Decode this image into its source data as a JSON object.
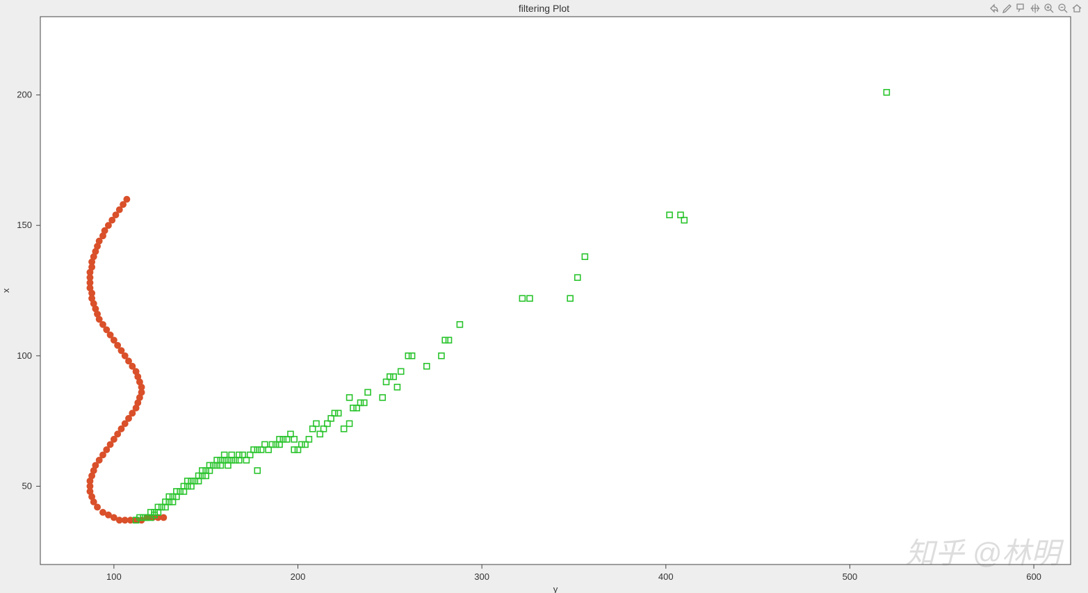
{
  "title": "filtering Plot",
  "xlabel": "y",
  "ylabel": "x",
  "watermark": "知乎 @林明",
  "toolbar": {
    "share": "share-icon",
    "brush": "brush-icon",
    "datatips": "datatips-icon",
    "pan": "pan-icon",
    "zoomin": "zoom-in-icon",
    "zoomout": "zoom-out-icon",
    "home": "home-icon"
  },
  "chart_data": {
    "type": "scatter",
    "xlim": [
      60,
      620
    ],
    "ylim": [
      20,
      230
    ],
    "xticks": [
      100,
      200,
      300,
      400,
      500,
      600
    ],
    "yticks": [
      50,
      100,
      150,
      200
    ],
    "series": [
      {
        "name": "orange",
        "color": "#d9502a",
        "marker": "circle",
        "filled": true,
        "points_xy": [
          [
            107,
            160
          ],
          [
            105,
            158
          ],
          [
            103,
            156
          ],
          [
            101,
            154
          ],
          [
            99,
            152
          ],
          [
            97,
            150
          ],
          [
            95,
            148
          ],
          [
            94,
            146
          ],
          [
            92,
            144
          ],
          [
            91,
            142
          ],
          [
            90,
            140
          ],
          [
            89,
            138
          ],
          [
            88,
            136
          ],
          [
            88,
            134
          ],
          [
            87,
            132
          ],
          [
            87,
            130
          ],
          [
            87,
            128
          ],
          [
            87,
            126
          ],
          [
            88,
            124
          ],
          [
            88,
            122
          ],
          [
            89,
            120
          ],
          [
            90,
            118
          ],
          [
            91,
            116
          ],
          [
            92,
            114
          ],
          [
            94,
            112
          ],
          [
            96,
            110
          ],
          [
            98,
            108
          ],
          [
            100,
            106
          ],
          [
            102,
            104
          ],
          [
            104,
            102
          ],
          [
            106,
            100
          ],
          [
            108,
            98
          ],
          [
            110,
            96
          ],
          [
            112,
            94
          ],
          [
            113,
            92
          ],
          [
            114,
            90
          ],
          [
            115,
            88
          ],
          [
            115,
            86
          ],
          [
            114,
            84
          ],
          [
            113,
            82
          ],
          [
            112,
            80
          ],
          [
            110,
            78
          ],
          [
            108,
            76
          ],
          [
            106,
            74
          ],
          [
            104,
            72
          ],
          [
            102,
            70
          ],
          [
            100,
            68
          ],
          [
            98,
            66
          ],
          [
            96,
            64
          ],
          [
            94,
            62
          ],
          [
            92,
            60
          ],
          [
            90,
            58
          ],
          [
            89,
            56
          ],
          [
            88,
            54
          ],
          [
            87,
            52
          ],
          [
            87,
            50
          ],
          [
            87,
            48
          ],
          [
            88,
            46
          ],
          [
            89,
            44
          ],
          [
            91,
            42
          ],
          [
            94,
            40
          ],
          [
            97,
            39
          ],
          [
            100,
            38
          ],
          [
            103,
            37
          ],
          [
            106,
            37
          ],
          [
            109,
            37
          ],
          [
            112,
            37
          ],
          [
            115,
            37
          ],
          [
            118,
            38
          ],
          [
            121,
            38
          ],
          [
            124,
            38
          ],
          [
            127,
            38
          ]
        ]
      },
      {
        "name": "green",
        "color": "#28c32b",
        "marker": "square",
        "filled": false,
        "points_xy": [
          [
            112,
            37
          ],
          [
            114,
            38
          ],
          [
            116,
            38
          ],
          [
            118,
            38
          ],
          [
            120,
            38
          ],
          [
            120,
            40
          ],
          [
            122,
            40
          ],
          [
            122,
            39
          ],
          [
            124,
            40
          ],
          [
            124,
            42
          ],
          [
            126,
            42
          ],
          [
            128,
            42
          ],
          [
            128,
            44
          ],
          [
            130,
            44
          ],
          [
            130,
            46
          ],
          [
            132,
            44
          ],
          [
            132,
            46
          ],
          [
            134,
            46
          ],
          [
            134,
            48
          ],
          [
            136,
            48
          ],
          [
            138,
            48
          ],
          [
            138,
            50
          ],
          [
            140,
            50
          ],
          [
            140,
            52
          ],
          [
            142,
            50
          ],
          [
            142,
            52
          ],
          [
            144,
            52
          ],
          [
            146,
            52
          ],
          [
            146,
            54
          ],
          [
            148,
            54
          ],
          [
            148,
            56
          ],
          [
            150,
            54
          ],
          [
            150,
            56
          ],
          [
            152,
            56
          ],
          [
            152,
            58
          ],
          [
            154,
            58
          ],
          [
            156,
            58
          ],
          [
            156,
            60
          ],
          [
            158,
            58
          ],
          [
            158,
            60
          ],
          [
            160,
            60
          ],
          [
            160,
            62
          ],
          [
            162,
            58
          ],
          [
            162,
            60
          ],
          [
            164,
            60
          ],
          [
            164,
            62
          ],
          [
            166,
            60
          ],
          [
            168,
            60
          ],
          [
            168,
            62
          ],
          [
            170,
            62
          ],
          [
            172,
            60
          ],
          [
            174,
            62
          ],
          [
            176,
            64
          ],
          [
            178,
            64
          ],
          [
            178,
            56
          ],
          [
            180,
            64
          ],
          [
            182,
            66
          ],
          [
            184,
            64
          ],
          [
            186,
            66
          ],
          [
            188,
            66
          ],
          [
            190,
            68
          ],
          [
            190,
            66
          ],
          [
            192,
            68
          ],
          [
            194,
            68
          ],
          [
            196,
            70
          ],
          [
            198,
            64
          ],
          [
            198,
            68
          ],
          [
            200,
            64
          ],
          [
            202,
            66
          ],
          [
            204,
            66
          ],
          [
            206,
            68
          ],
          [
            208,
            72
          ],
          [
            210,
            74
          ],
          [
            212,
            70
          ],
          [
            214,
            72
          ],
          [
            216,
            74
          ],
          [
            218,
            76
          ],
          [
            220,
            78
          ],
          [
            222,
            78
          ],
          [
            225,
            72
          ],
          [
            228,
            74
          ],
          [
            228,
            84
          ],
          [
            230,
            80
          ],
          [
            232,
            80
          ],
          [
            234,
            82
          ],
          [
            236,
            82
          ],
          [
            238,
            86
          ],
          [
            246,
            84
          ],
          [
            248,
            90
          ],
          [
            250,
            92
          ],
          [
            252,
            92
          ],
          [
            254,
            88
          ],
          [
            256,
            94
          ],
          [
            260,
            100
          ],
          [
            262,
            100
          ],
          [
            270,
            96
          ],
          [
            278,
            100
          ],
          [
            280,
            106
          ],
          [
            282,
            106
          ],
          [
            288,
            112
          ],
          [
            322,
            122
          ],
          [
            326,
            122
          ],
          [
            348,
            122
          ],
          [
            352,
            130
          ],
          [
            356,
            138
          ],
          [
            402,
            154
          ],
          [
            408,
            154
          ],
          [
            410,
            152
          ],
          [
            520,
            201
          ]
        ]
      }
    ]
  }
}
